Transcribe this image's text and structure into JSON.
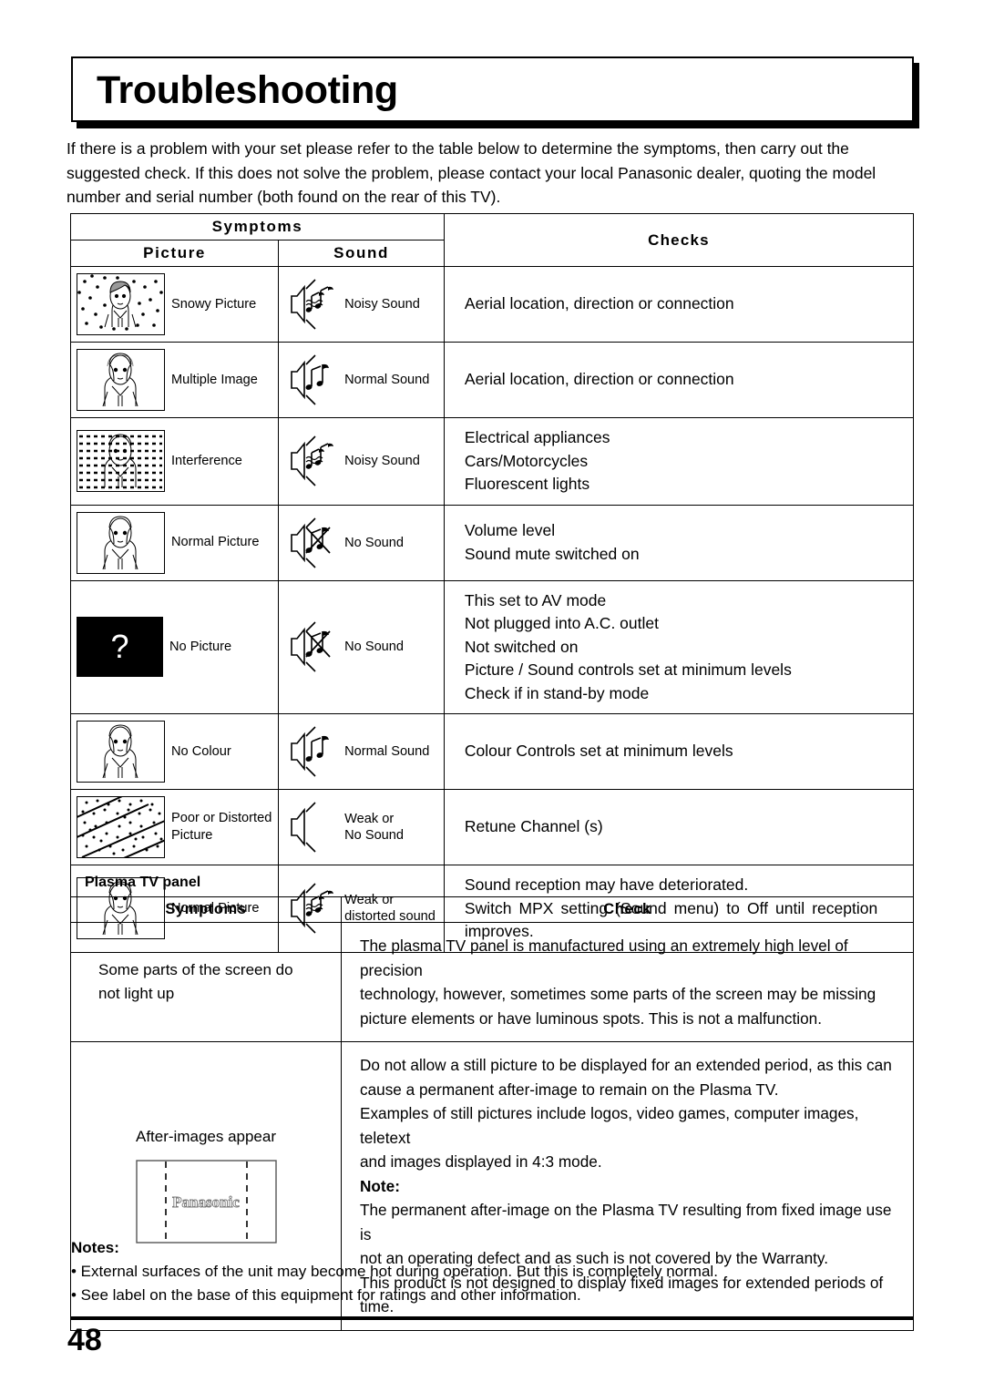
{
  "page": {
    "title": "Troubleshooting",
    "page_number": "48",
    "intro_lines": [
      "If there is a problem with your set please refer to the table below to determine the symptoms, then carry out the",
      "suggested check. If this does not solve the problem, please contact your local Panasonic dealer, quoting the model",
      "number and serial number (both found on the rear of this TV)."
    ]
  },
  "main_table": {
    "header": {
      "symptoms": "Symptoms",
      "picture": "Picture",
      "sound": "Sound",
      "checks": "Checks"
    },
    "rows": [
      {
        "picture_icon": "snowy-picture-icon",
        "picture_label": "Snowy Picture",
        "sound_icon": "noisy-sound-icon",
        "sound_label": "Noisy Sound",
        "checks": [
          "Aerial location, direction or connection"
        ]
      },
      {
        "picture_icon": "multiple-image-icon",
        "picture_label": "Multiple Image",
        "sound_icon": "normal-sound-icon",
        "sound_label": "Normal Sound",
        "checks": [
          "Aerial location, direction or connection"
        ]
      },
      {
        "picture_icon": "interference-icon",
        "picture_label": "Interference",
        "sound_icon": "noisy-sound-icon",
        "sound_label": "Noisy Sound",
        "checks": [
          "Electrical appliances",
          "Cars/Motorcycles",
          "Fluorescent lights"
        ]
      },
      {
        "picture_icon": "normal-picture-icon",
        "picture_label": "Normal Picture",
        "sound_icon": "no-sound-icon",
        "sound_label": "No Sound",
        "checks": [
          "Volume level",
          "Sound mute switched on"
        ]
      },
      {
        "picture_icon": "no-picture-icon",
        "picture_label": "No Picture",
        "sound_icon": "no-sound-icon",
        "sound_label": "No Sound",
        "checks": [
          "This set to AV mode",
          "Not plugged into A.C. outlet",
          "Not switched on",
          "Picture / Sound controls set at minimum levels",
          "Check if in stand-by mode"
        ]
      },
      {
        "picture_icon": "no-colour-icon",
        "picture_label": "No Colour",
        "sound_icon": "normal-sound-icon",
        "sound_label": "Normal Sound",
        "checks": [
          "Colour Controls set at minimum levels"
        ]
      },
      {
        "picture_icon": "poor-distorted-picture-icon",
        "picture_label_lines": [
          "Poor or Distorted",
          "Picture"
        ],
        "sound_icon": "weak-sound-icon",
        "sound_label_lines": [
          "Weak or",
          "No Sound"
        ],
        "checks": [
          "Retune Channel (s)"
        ]
      },
      {
        "picture_icon": "normal-picture-icon",
        "picture_label": "Normal Picture",
        "sound_icon": "weak-distorted-sound-icon",
        "sound_label_lines": [
          "Weak or",
          "distorted sound"
        ],
        "checks": [
          "Sound reception may have deteriorated.",
          "Switch MPX setting (Sound menu) to Off until reception",
          "improves."
        ],
        "checks_justify": true
      }
    ]
  },
  "plasma_section": {
    "heading": "Plasma TV panel",
    "header": {
      "symptoms": "Symptoms",
      "check": "Check"
    },
    "rows": [
      {
        "symptom_lines": [
          "Some parts of the screen do",
          "not light up"
        ],
        "check_paragraphs": [
          {
            "bold": false,
            "lines": [
              "The plasma TV panel is manufactured using an extremely high level of precision",
              "technology, however, sometimes some parts of the screen may be missing",
              "picture elements or have luminous spots. This is not a malfunction."
            ]
          }
        ]
      },
      {
        "symptom_lines": [
          "After-images appear"
        ],
        "diagram_label": "Panasonic",
        "check_paragraphs": [
          {
            "bold": false,
            "lines": [
              "Do not allow a still picture to be displayed for an extended period, as this can",
              "cause a permanent after-image to remain on the Plasma TV.",
              "Examples of still pictures include logos, video games, computer images, teletext",
              "and images displayed in 4:3 mode."
            ]
          },
          {
            "bold": true,
            "lines": [
              "Note:"
            ]
          },
          {
            "bold": false,
            "lines": [
              "The permanent after-image on the Plasma TV resulting from fixed image use is",
              "not an operating defect and as such is not covered by the Warranty.",
              "This product is not designed to display fixed images for extended periods of",
              "time."
            ]
          }
        ]
      }
    ]
  },
  "notes": {
    "heading": "Notes:",
    "items": [
      "• External surfaces of the unit may become hot during operation. But this is completely normal.",
      "• See label on the base of this equipment for ratings and other information."
    ]
  },
  "colors": {
    "ink": "#000000",
    "paper": "#ffffff"
  }
}
